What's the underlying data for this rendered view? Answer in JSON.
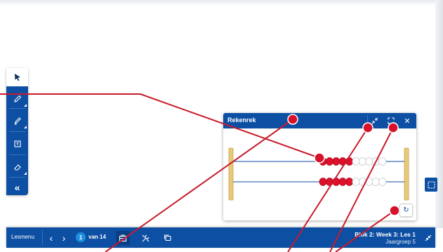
{
  "toolbar": {
    "tools": [
      {
        "name": "pointer-tool",
        "icon": "arrow-cursor-icon",
        "active": true
      },
      {
        "name": "pencil-tool",
        "icon": "pencil-icon"
      },
      {
        "name": "highlighter-tool",
        "icon": "marker-icon"
      },
      {
        "name": "textbox-tool",
        "icon": "text-box-icon"
      },
      {
        "name": "eraser-tool",
        "icon": "eraser-icon"
      },
      {
        "name": "collapse-toolbar",
        "icon": "double-chevron-left-icon",
        "symbol": "«"
      }
    ]
  },
  "panel": {
    "title": "Rekenrek",
    "buttons": [
      "minimize-icon",
      "fullscreen-icon",
      "close-icon"
    ],
    "close_symbol": "✕",
    "reset_symbol": "↻"
  },
  "abacus": {
    "rows": [
      {
        "red_beads": 5,
        "white_beads": 5,
        "red_on_left": 0,
        "red_near_center": 5
      },
      {
        "red_beads": 5,
        "white_beads": 5,
        "red_on_left": 0,
        "red_near_center": 5
      }
    ],
    "colors": {
      "frame": "#e8c979",
      "rod": "#0d4fa3",
      "red": "#e0102a",
      "white": "#ffffff"
    }
  },
  "bottombar": {
    "menu_label": "Lesmenu",
    "prev_symbol": "‹",
    "next_symbol": "›",
    "current_page": "1",
    "page_total_label": "van 14",
    "lesson_title": "Blok 2: Week 3: Les 1",
    "lesson_group": "Jaargroep 5"
  },
  "colors": {
    "primary": "#0d4fa3",
    "accent": "#1e8fe0",
    "annotation": "#c81b2c"
  }
}
